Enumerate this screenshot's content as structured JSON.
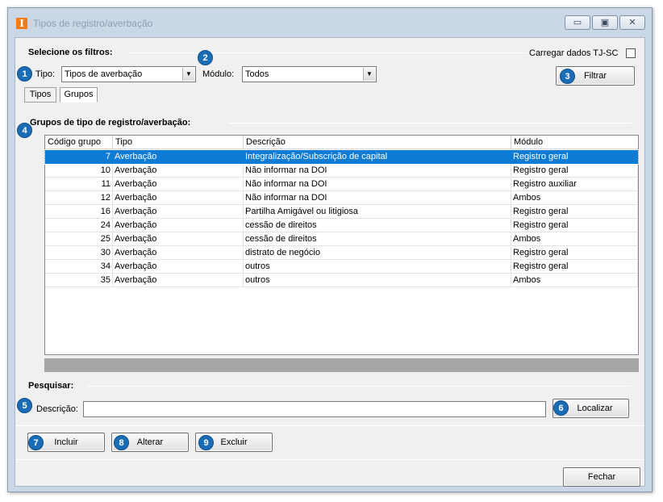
{
  "window": {
    "title": "Tipos de registro/averbação",
    "icon_letter": "I",
    "minimize": "▭",
    "restore": "▣",
    "close": "✕"
  },
  "filters": {
    "section_title": "Selecione os filtros:",
    "load_tjsc_label": "Carregar dados TJ-SC",
    "load_tjsc_checked": false,
    "tipo_label": "Tipo:",
    "tipo_value": "Tipos de averbação",
    "modulo_label": "Módulo:",
    "modulo_value": "Todos",
    "filter_button": "Filtrar"
  },
  "tabs": [
    {
      "label": "Tipos",
      "active": false
    },
    {
      "label": "Grupos",
      "active": true
    }
  ],
  "groups": {
    "section_title": "Grupos de tipo de registro/averbação:",
    "columns": [
      "Código grupo",
      "Tipo",
      "Descrição",
      "Módulo"
    ],
    "rows": [
      {
        "codigo": "7",
        "tipo": "Averbação",
        "descricao": "Integralização/Subscrição de capital",
        "modulo": "Registro geral",
        "selected": true
      },
      {
        "codigo": "10",
        "tipo": "Averbação",
        "descricao": "Não informar na DOI",
        "modulo": "Registro geral"
      },
      {
        "codigo": "11",
        "tipo": "Averbação",
        "descricao": "Não informar na DOI",
        "modulo": "Registro auxiliar"
      },
      {
        "codigo": "12",
        "tipo": "Averbação",
        "descricao": "Não informar na DOI",
        "modulo": "Ambos"
      },
      {
        "codigo": "16",
        "tipo": "Averbação",
        "descricao": "Partilha Amigável ou litigiosa",
        "modulo": "Registro geral"
      },
      {
        "codigo": "24",
        "tipo": "Averbação",
        "descricao": "cessão de direitos",
        "modulo": "Registro geral"
      },
      {
        "codigo": "25",
        "tipo": "Averbação",
        "descricao": "cessão de direitos",
        "modulo": "Ambos"
      },
      {
        "codigo": "30",
        "tipo": "Averbação",
        "descricao": "distrato de negócio",
        "modulo": "Registro geral"
      },
      {
        "codigo": "34",
        "tipo": "Averbação",
        "descricao": "outros",
        "modulo": "Registro geral"
      },
      {
        "codigo": "35",
        "tipo": "Averbação",
        "descricao": "outros",
        "modulo": "Ambos"
      }
    ]
  },
  "search": {
    "section_title": "Pesquisar:",
    "descricao_label": "Descrição:",
    "descricao_value": "",
    "find_button": "Localizar"
  },
  "actions": {
    "include": "Incluir",
    "edit": "Alterar",
    "delete": "Excluir",
    "close": "Fechar"
  },
  "badges": [
    "1",
    "2",
    "3",
    "4",
    "5",
    "6",
    "7",
    "8",
    "9"
  ],
  "colors": {
    "badge": "#1a6db5",
    "selection": "#0e7bd4",
    "app_icon": "#f07d1a"
  }
}
